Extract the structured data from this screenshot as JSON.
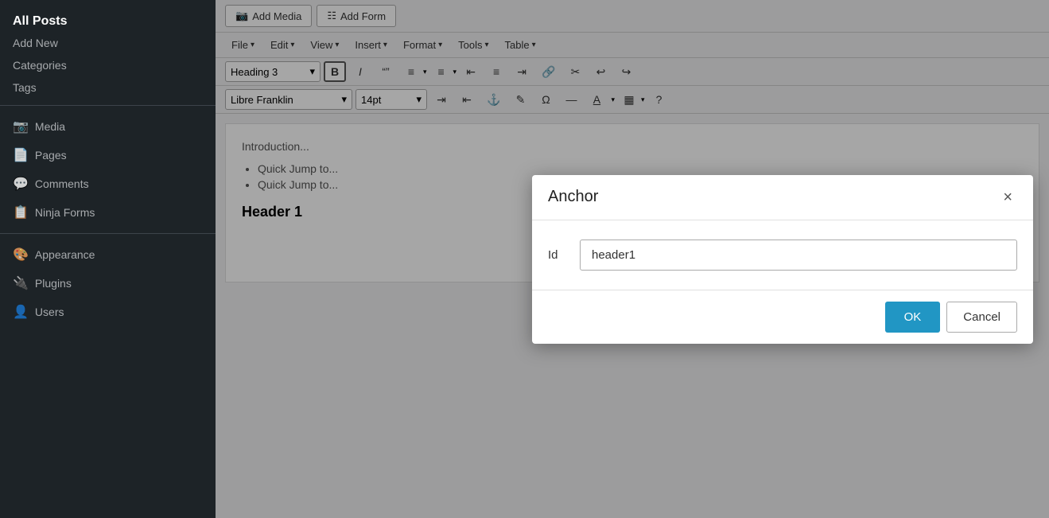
{
  "sidebar": {
    "items": [
      {
        "label": "All Posts",
        "icon": "",
        "active": true,
        "type": "main"
      },
      {
        "label": "Add New",
        "icon": "",
        "active": false,
        "type": "sub"
      },
      {
        "label": "Categories",
        "icon": "",
        "active": false,
        "type": "sub"
      },
      {
        "label": "Tags",
        "icon": "",
        "active": false,
        "type": "sub"
      },
      {
        "label": "Media",
        "icon": "🖼",
        "active": false,
        "type": "main"
      },
      {
        "label": "Pages",
        "icon": "📄",
        "active": false,
        "type": "main"
      },
      {
        "label": "Comments",
        "icon": "💬",
        "active": false,
        "type": "main"
      },
      {
        "label": "Ninja Forms",
        "icon": "📋",
        "active": false,
        "type": "main"
      },
      {
        "label": "Appearance",
        "icon": "🎨",
        "active": false,
        "type": "main"
      },
      {
        "label": "Plugins",
        "icon": "🔌",
        "active": false,
        "type": "main"
      },
      {
        "label": "Users",
        "icon": "👤",
        "active": false,
        "type": "main"
      }
    ]
  },
  "toolbar": {
    "add_media_label": "Add Media",
    "add_form_label": "Add Form"
  },
  "menu_bar": {
    "items": [
      "File",
      "Edit",
      "View",
      "Insert",
      "Format",
      "Tools",
      "Table"
    ]
  },
  "format_bar": {
    "heading_select": "Heading 3",
    "buttons": [
      "B",
      "I",
      "\"\"",
      "≡",
      "≡",
      "≡",
      "≡",
      "≡",
      "🔗",
      "✂",
      "↩",
      "↪"
    ]
  },
  "font_bar": {
    "font_select": "Libre Franklin",
    "size_select": "14pt"
  },
  "editor": {
    "intro_text": "Introduction...",
    "list_items": [
      "Quick Jump to...",
      "Quick Jump to..."
    ],
    "heading": "Header 1"
  },
  "modal": {
    "title": "Anchor",
    "close_label": "×",
    "id_label": "Id",
    "id_value": "header1",
    "ok_label": "OK",
    "cancel_label": "Cancel"
  }
}
